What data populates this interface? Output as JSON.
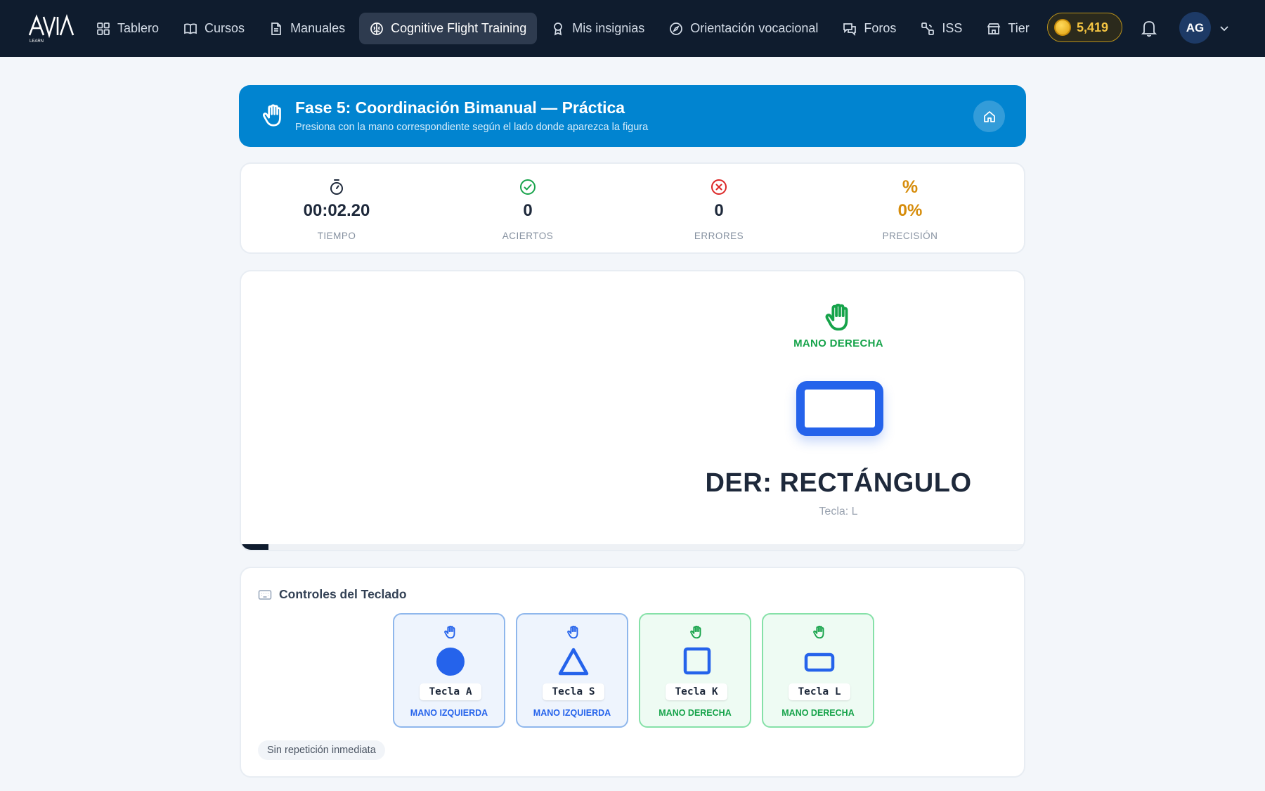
{
  "nav": {
    "logo_text": "AVIA",
    "logo_subtext": "LEARN",
    "items": [
      {
        "label": "Tablero",
        "icon": "dashboard-icon"
      },
      {
        "label": "Cursos",
        "icon": "book-icon"
      },
      {
        "label": "Manuales",
        "icon": "document-icon"
      },
      {
        "label": "Cognitive Flight Training",
        "icon": "brain-icon",
        "active": true
      },
      {
        "label": "Mis insignias",
        "icon": "badge-icon"
      },
      {
        "label": "Orientación vocacional",
        "icon": "compass-icon"
      },
      {
        "label": "Foros",
        "icon": "chat-icon"
      },
      {
        "label": "ISS",
        "icon": "satellite-icon"
      },
      {
        "label": "Tier",
        "icon": "store-icon"
      }
    ],
    "coins": "5,419",
    "user_initials": "AG"
  },
  "phase": {
    "title": "Fase 5: Coordinación Bimanual — Práctica",
    "subtitle": "Presiona con la mano correspondiente según el lado donde aparezca la figura"
  },
  "stats": {
    "time": {
      "value": "00:02.20",
      "label": "TIEMPO"
    },
    "hits": {
      "value": "0",
      "label": "ACIERTOS"
    },
    "errors": {
      "value": "0",
      "label": "ERRORES"
    },
    "precision": {
      "glyph": "%",
      "value": "0%",
      "label": "PRECISIÓN"
    }
  },
  "game": {
    "hand_label": "MANO DERECHA",
    "target_label": "DER: RECTÁNGULO",
    "target_key": "Tecla: L",
    "progress_fraction": 0.035
  },
  "controls": {
    "title": "Controles del Teclado",
    "keys": [
      {
        "key": "Tecla A",
        "hand": "MANO IZQUIERDA",
        "shape": "circle"
      },
      {
        "key": "Tecla S",
        "hand": "MANO IZQUIERDA",
        "shape": "triangle"
      },
      {
        "key": "Tecla K",
        "hand": "MANO DERECHA",
        "shape": "square"
      },
      {
        "key": "Tecla L",
        "hand": "MANO DERECHA",
        "shape": "rectangle"
      }
    ],
    "note": "Sin repetición inmediata"
  },
  "colors": {
    "navbar_bg": "#0f1c2e",
    "header_blue": "#0184d0",
    "left_hand": "#2563eb",
    "right_hand": "#16a34a",
    "precision_accent": "#d68c0a",
    "coin_gold": "#f5c542"
  }
}
